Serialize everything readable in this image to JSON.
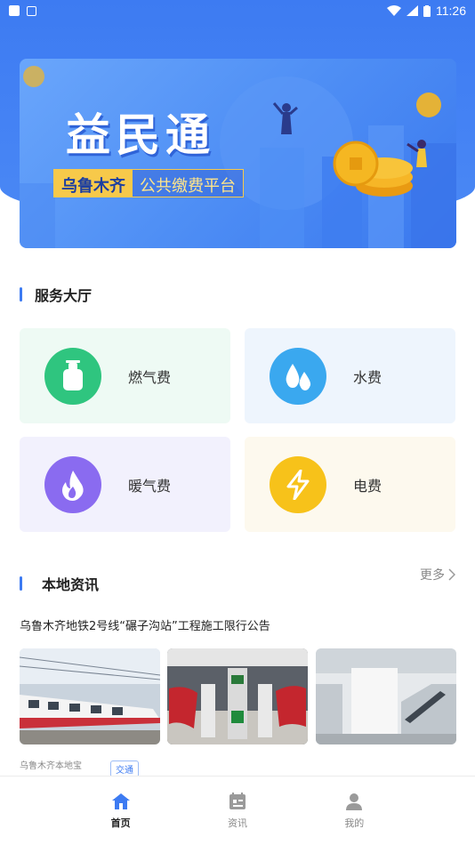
{
  "status_bar": {
    "time": "11:26"
  },
  "banner": {
    "title": "益民通",
    "tag_city": "乌鲁木齐",
    "tag_desc": "公共缴费平台"
  },
  "services": {
    "section_title": "服务大厅",
    "items": [
      {
        "label": "燃气费",
        "icon": "gas-cylinder-icon",
        "color": "#2fc57f",
        "bg": "#eefaf4"
      },
      {
        "label": "水费",
        "icon": "water-drop-icon",
        "color": "#3aa8ef",
        "bg": "#eef5fd"
      },
      {
        "label": "暖气费",
        "icon": "flame-icon",
        "color": "#8a6bf0",
        "bg": "#f2f1fd"
      },
      {
        "label": "电费",
        "icon": "lightning-icon",
        "color": "#f7c21a",
        "bg": "#fdf9ee"
      }
    ]
  },
  "news": {
    "section_title": "本地资讯",
    "more_label": "更多",
    "headline": "乌鲁木齐地铁2号线“碾子沟站”工程施工限行公告",
    "source": "乌鲁木齐本地宝",
    "category": "交通"
  },
  "tabbar": {
    "items": [
      {
        "label": "首页",
        "icon": "home-icon",
        "active": true
      },
      {
        "label": "资讯",
        "icon": "news-icon",
        "active": false
      },
      {
        "label": "我的",
        "icon": "profile-icon",
        "active": false
      }
    ]
  },
  "colors": {
    "primary": "#3d7bf2"
  }
}
